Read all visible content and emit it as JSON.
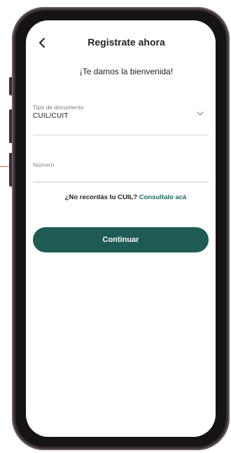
{
  "header": {
    "back_icon": "chevron-left-icon",
    "title": "Registrate ahora"
  },
  "welcome_text": "¡Te damos la bienvenida!",
  "form": {
    "document_type": {
      "label": "Tipo de documento",
      "value": "CUIL/CUIT",
      "icon": "chevron-down-icon"
    },
    "number": {
      "placeholder": "Número"
    }
  },
  "hint": {
    "question": "¿No recordás tu CUIL?",
    "link": "Consultalo acá"
  },
  "continue_button": "Continuar",
  "colors": {
    "primary": "#1e5b55",
    "link": "#1e6b5e",
    "callout": "#d8643f",
    "frame": "#3a3036"
  }
}
